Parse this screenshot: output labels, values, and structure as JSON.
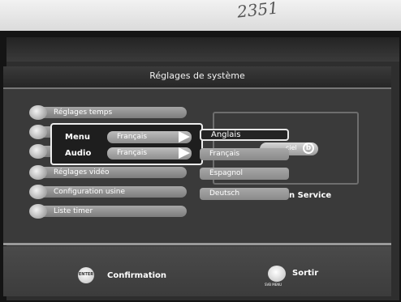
{
  "header": {
    "title": "Réglages de système"
  },
  "menu": {
    "items": [
      {
        "label": "Réglages temps",
        "icon": "clock-icon"
      },
      {
        "label": "",
        "icon": "language-icon"
      },
      {
        "label": "",
        "icon": "audio-icon"
      },
      {
        "label": "Réglages vidéo",
        "icon": "video-icon"
      },
      {
        "label": "Configuration usine",
        "icon": "factory-reset-icon"
      },
      {
        "label": "Liste timer",
        "icon": "timer-icon"
      }
    ]
  },
  "popup": {
    "menu_label": "Menu",
    "menu_value": "Français",
    "audio_label": "Audio",
    "audio_value": "Français"
  },
  "language_list": [
    "Anglais",
    "Français",
    "Espagnol",
    "Deutsch"
  ],
  "info": {
    "badge_text": "ciel",
    "service_text": "n Service"
  },
  "footer": {
    "confirm_key": "ENTER",
    "confirm_label": "Confirmation",
    "exit_key": "SVB MENU",
    "exit_label": "Sortir"
  },
  "handwriting": "2351"
}
